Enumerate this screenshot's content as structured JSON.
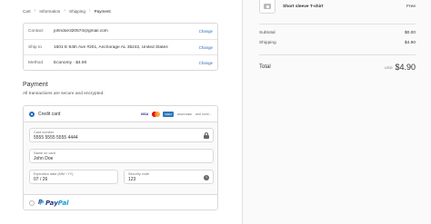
{
  "breadcrumb": {
    "items": [
      "Cart",
      "Information",
      "Shipping",
      "Payment"
    ]
  },
  "review": {
    "rows": [
      {
        "label": "Contact",
        "value": "johndoe320674@gmail.com",
        "action": "Change"
      },
      {
        "label": "Ship to",
        "value": "1601 E 84th Ave #201, Anchorage AL 35242, United States",
        "action": "Change"
      },
      {
        "label": "Method",
        "value": "Economy · $4.90",
        "action": "Change"
      }
    ]
  },
  "payment": {
    "title": "Payment",
    "subtitle": "All transactions are secure and encrypted.",
    "credit_card_label": "Credit card",
    "brands": {
      "visa": "VISA",
      "amex": "AMEX",
      "discover": "DISCOVER",
      "more": "and more..."
    },
    "card_number": {
      "label": "Card number",
      "value": "5555 5555 5555 4444"
    },
    "name_on_card": {
      "label": "Name on card",
      "value": "John Doe"
    },
    "expiration": {
      "label": "Expiration date (MM / YY)",
      "value": "07 / 26"
    },
    "security_code": {
      "label": "Security code",
      "value": "123"
    },
    "help_glyph": "?",
    "paypal": {
      "pay": "Pay",
      "pal": "Pal"
    }
  },
  "summary": {
    "item_name": "Short sleeve T-shirt",
    "item_price": "Free",
    "subtotal_label": "Subtotal",
    "subtotal_value": "$0.00",
    "shipping_label": "Shipping",
    "shipping_value": "$4.90",
    "total_label": "Total",
    "currency": "USD",
    "total_value": "$4.90"
  },
  "colors": {
    "accent": "#2a6ebb",
    "paypal_dark": "#253b80",
    "paypal_light": "#179bd7"
  },
  "icons": {
    "selected_radio": "radio-selected-icon",
    "lock": "lock-icon",
    "help": "help-circle-icon",
    "product": "camera-placeholder-icon"
  }
}
